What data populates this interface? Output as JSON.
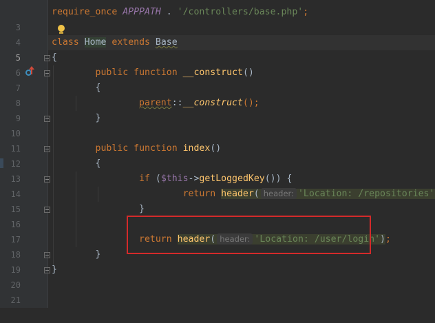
{
  "lines": [
    {
      "num": "3",
      "code": "require_once APPPATH . '/controllers/base.php';"
    },
    {
      "num": "4",
      "code": ""
    },
    {
      "num": "5",
      "code": "class Home extends Base"
    },
    {
      "num": "6",
      "code": "{"
    },
    {
      "num": "7",
      "code": "public function __construct()"
    },
    {
      "num": "8",
      "code": "{"
    },
    {
      "num": "9",
      "code": "parent::__construct();"
    },
    {
      "num": "10",
      "code": "}"
    },
    {
      "num": "11",
      "code": ""
    },
    {
      "num": "12",
      "code": "public function index()"
    },
    {
      "num": "13",
      "code": "{"
    },
    {
      "num": "14",
      "code": "if ($this->getLoggedKey()) {"
    },
    {
      "num": "15",
      "code": "return header( header: 'Location: /repositories');"
    },
    {
      "num": "16",
      "code": "}"
    },
    {
      "num": "17",
      "code": ""
    },
    {
      "num": "18",
      "code": "return header( header: 'Location: /user/login');"
    },
    {
      "num": "19",
      "code": "}"
    },
    {
      "num": "20",
      "code": "}"
    },
    {
      "num": "21",
      "code": ""
    }
  ],
  "tokens": {
    "require_once": "require_once",
    "apppath": "APPPATH",
    "dot": " . ",
    "base_path": "'/controllers/base.php'",
    "semicolon": ";",
    "class_kw": "class",
    "class_name": "Home",
    "extends_kw": "extends",
    "parent_class": "Base",
    "open_brace": "{",
    "close_brace": "}",
    "public_kw": "public",
    "function_kw": "function",
    "construct_name": "__construct",
    "parens": "()",
    "parent_kw": "parent",
    "scope_op": "::",
    "parent_construct": "__construct",
    "call_end": "();",
    "index_name": "index",
    "if_kw": "if",
    "if_open": " (",
    "this_var": "$this",
    "arrow": "->",
    "get_logged_key": "getLoggedKey",
    "if_close": "()) {",
    "return_kw": "return",
    "header_fn": "header",
    "paren_open": "(",
    "param_hint": "header:",
    "repositories_str": "'Location: /repositories'",
    "login_str": "'Location: /user/login'",
    "paren_close": ")",
    "stmt_end": ";"
  },
  "colors": {
    "background": "#2b2b2b",
    "gutter": "#313335",
    "keyword": "#cc7832",
    "string": "#6a8759",
    "function": "#ffc66d",
    "variable": "#9876aa",
    "highlight_box": "#d42a2a"
  },
  "icons": {
    "intention": "lightbulb-icon",
    "override": "overrides-method-icon",
    "fold": "fold-marker-icon"
  }
}
